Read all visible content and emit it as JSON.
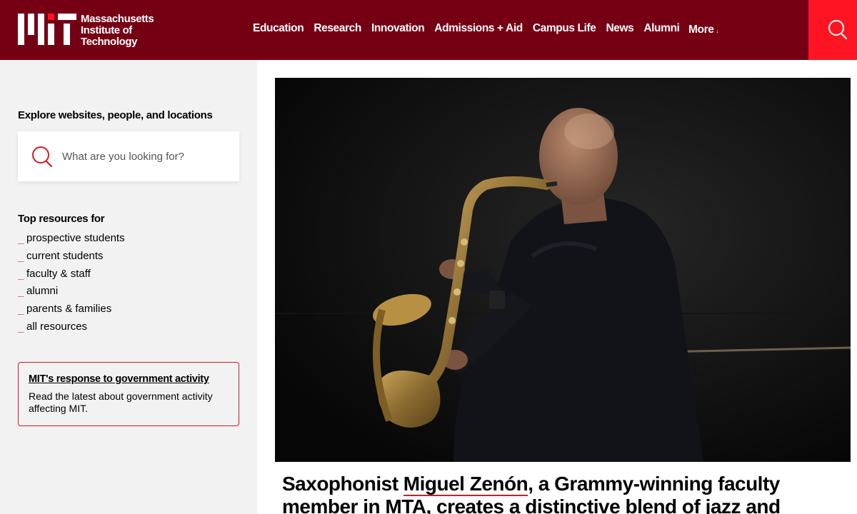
{
  "header": {
    "logo_text": [
      "Massachusetts",
      "Institute of",
      "Technology"
    ],
    "nav": [
      "Education",
      "Research",
      "Innovation",
      "Admissions + Aid",
      "Campus Life",
      "News",
      "Alumni"
    ],
    "more_label": "More",
    "colors": {
      "header_bg": "#750014",
      "search_bg": "#ff1423",
      "accent": "#d61922"
    }
  },
  "sidebar": {
    "explore_title": "Explore websites, people, and locations",
    "search_placeholder": "What are you looking for?",
    "top_resources_title": "Top resources for",
    "resources": [
      "prospective students",
      "current students",
      "faculty & staff",
      "alumni",
      "parents & families",
      "all resources"
    ],
    "notice": {
      "title": "MIT's response to government activity",
      "body": "Read the latest about government activity affecting MIT."
    }
  },
  "main": {
    "headline_before": "Saxophonist ",
    "headline_name": "Miguel Zenón",
    "headline_after": ", a Grammy-winning faculty member in MTA, creates a distinctive blend of jazz and"
  }
}
